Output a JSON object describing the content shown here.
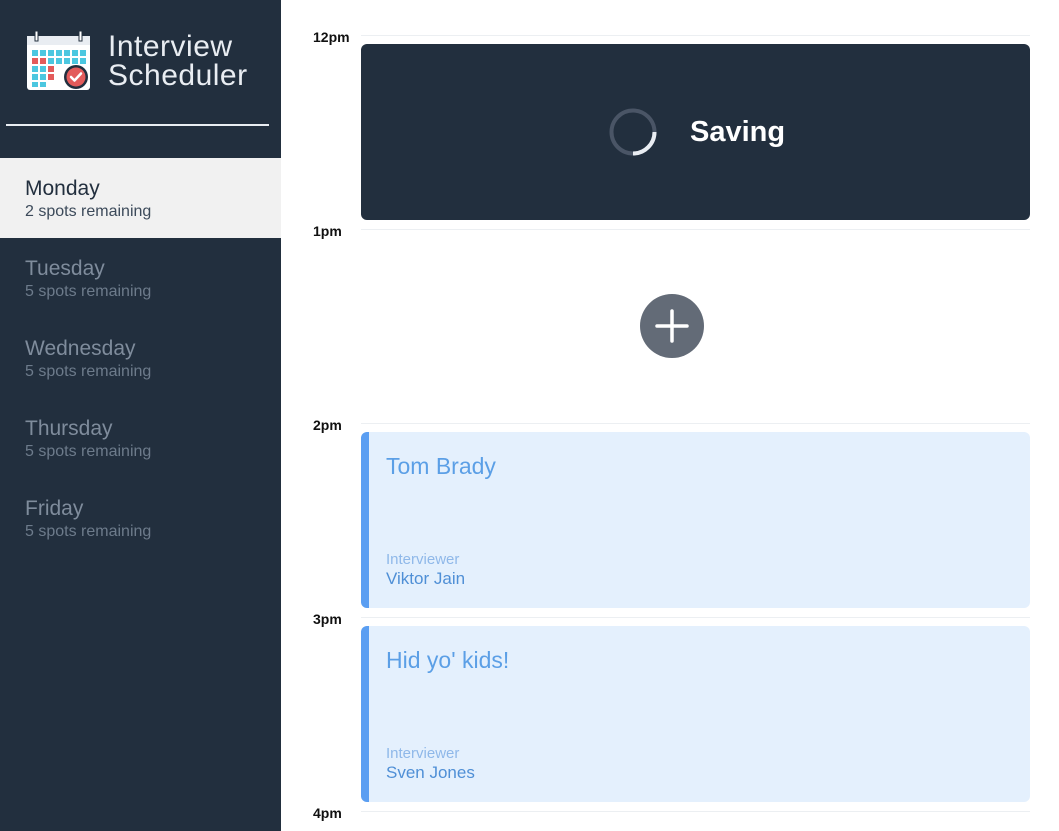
{
  "app": {
    "title_line1": "Interview",
    "title_line2": "Scheduler"
  },
  "days": [
    {
      "name": "Monday",
      "spots": "2 spots remaining",
      "selected": true
    },
    {
      "name": "Tuesday",
      "spots": "5 spots remaining",
      "selected": false
    },
    {
      "name": "Wednesday",
      "spots": "5 spots remaining",
      "selected": false
    },
    {
      "name": "Thursday",
      "spots": "5 spots remaining",
      "selected": false
    },
    {
      "name": "Friday",
      "spots": "5 spots remaining",
      "selected": false
    }
  ],
  "hours": [
    "12pm",
    "1pm",
    "2pm",
    "3pm",
    "4pm"
  ],
  "saving": {
    "label": "Saving"
  },
  "appointments": [
    {
      "student": "Tom Brady",
      "caption": "Interviewer",
      "interviewer": "Viktor Jain"
    },
    {
      "student": "Hid yo' kids!",
      "caption": "Interviewer",
      "interviewer": "Sven Jones"
    }
  ],
  "icons": {
    "logo": "calendar-check-icon",
    "spinner": "loading-spinner-icon",
    "add": "plus-icon"
  },
  "colors": {
    "sidebar_bg": "#222f3e",
    "selected_day_bg": "#f1f1f1",
    "appointment_bg": "#e4f0fd",
    "appointment_accent": "#5a9ef2",
    "add_button": "#636b77"
  }
}
